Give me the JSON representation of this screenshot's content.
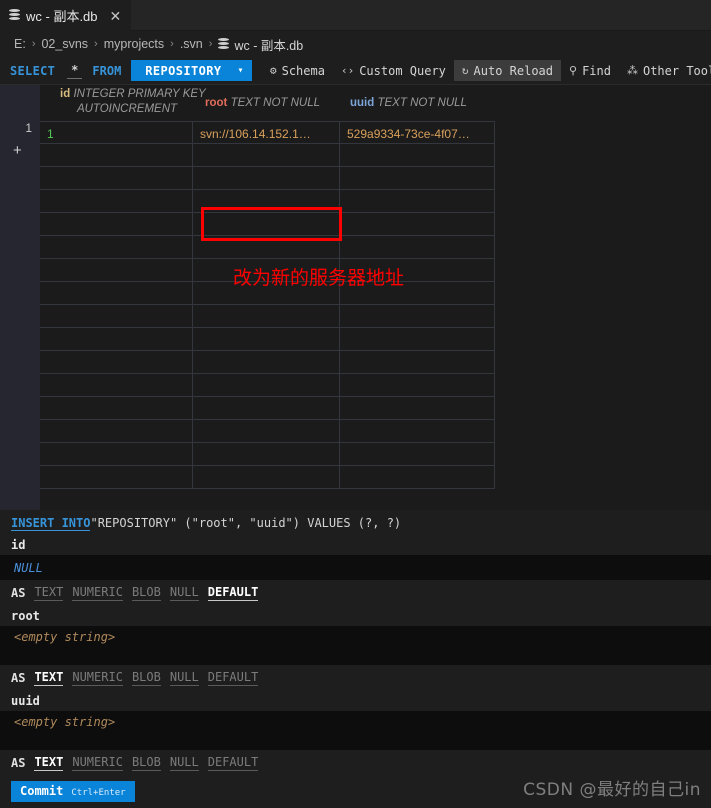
{
  "tab": {
    "title": "wc - 副本.db",
    "close_label": "✕",
    "icon": "database-icon"
  },
  "breadcrumb": {
    "items": [
      "E:",
      "02_svns",
      "myprojects",
      ".svn",
      "wc - 副本.db"
    ],
    "separator": "›"
  },
  "toolbar": {
    "select_kw": "SELECT",
    "star": "*",
    "from_kw": "FROM",
    "table_name": "REPOSITORY",
    "chevron": "▾",
    "schema_label": "Schema",
    "schema_icon": "⚙",
    "custom_query_label": "Custom Query",
    "custom_query_icon": "‹›",
    "auto_reload_label": "Auto Reload",
    "auto_reload_icon": "↻",
    "find_label": "Find",
    "find_icon": "⚲",
    "other_tools_label": "Other Tools…",
    "other_tools_icon": "⁂"
  },
  "grid": {
    "row_number": "1",
    "add_row_glyph": "+",
    "columns": [
      {
        "name": "id",
        "type_line1": "INTEGER PRIMARY KEY",
        "type_line2": "AUTOINCREMENT"
      },
      {
        "name": "root",
        "type_line1": "TEXT NOT NULL",
        "type_line2": ""
      },
      {
        "name": "uuid",
        "type_line1": "TEXT NOT NULL",
        "type_line2": ""
      }
    ],
    "rows": [
      {
        "id": "1",
        "root": "svn://106.14.152.1…",
        "uuid": "529a9334-73ce-4f07…"
      }
    ],
    "empty_row_count": 15
  },
  "annotation": {
    "text": "改为新的服务器地址",
    "color": "#ff0000",
    "highlight_target": "root-cell-row-1"
  },
  "insert_form": {
    "statement": {
      "keyword": "INSERT INTO",
      "rest": " \"REPOSITORY\" (\"root\", \"uuid\") VALUES (?, ?)"
    },
    "fields": [
      {
        "label": "id",
        "value": "NULL",
        "value_style": "null",
        "as_label": "AS",
        "options": [
          "TEXT",
          "NUMERIC",
          "BLOB",
          "NULL",
          "DEFAULT"
        ],
        "selected": "DEFAULT"
      },
      {
        "label": "root",
        "value": "<empty string>",
        "value_style": "empty",
        "as_label": "AS",
        "options": [
          "TEXT",
          "NUMERIC",
          "BLOB",
          "NULL",
          "DEFAULT"
        ],
        "selected": "TEXT"
      },
      {
        "label": "uuid",
        "value": "<empty string>",
        "value_style": "empty",
        "as_label": "AS",
        "options": [
          "TEXT",
          "NUMERIC",
          "BLOB",
          "NULL",
          "DEFAULT"
        ],
        "selected": "TEXT"
      }
    ],
    "commit_label": "Commit",
    "commit_shortcut": "Ctrl+Enter"
  },
  "watermark": "CSDN @最好的自己in",
  "colors": {
    "accent": "#0a84d8",
    "keyword": "#3794d8",
    "text_value": "#d9a05b",
    "num_value": "#52c954",
    "annotation": "#ff0000",
    "background": "#1e1e1e"
  }
}
